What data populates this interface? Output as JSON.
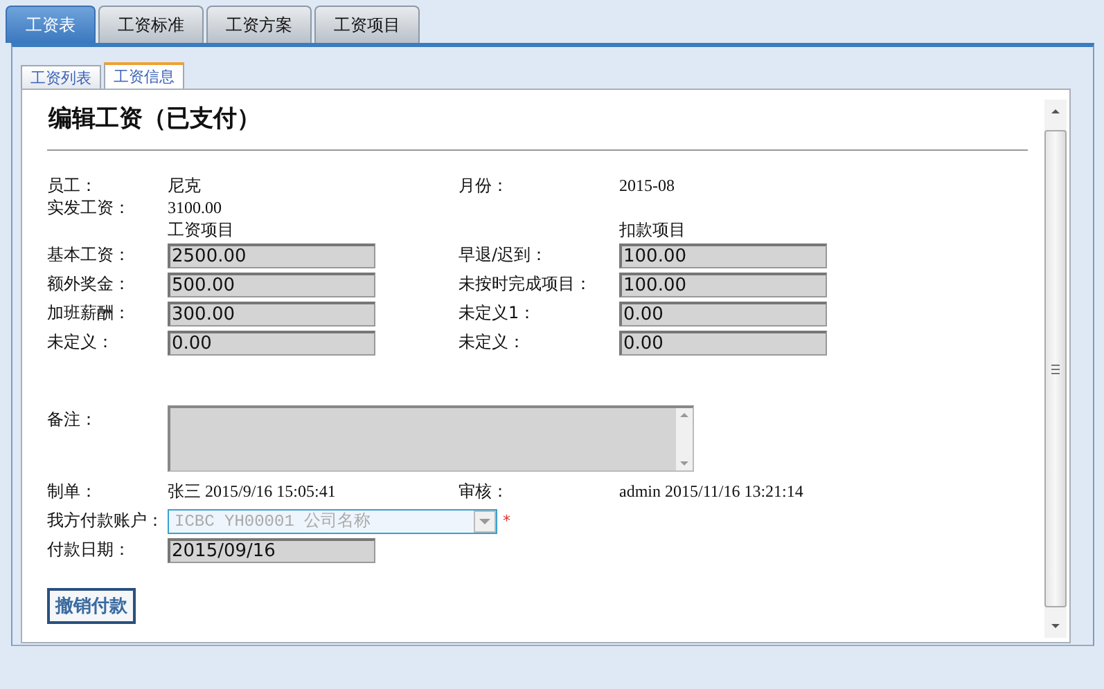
{
  "main_tabs": [
    {
      "label": "工资表",
      "selected": true
    },
    {
      "label": "工资标准",
      "selected": false
    },
    {
      "label": "工资方案",
      "selected": false
    },
    {
      "label": "工资项目",
      "selected": false
    }
  ],
  "sub_tabs": [
    {
      "label": "工资列表",
      "selected": false
    },
    {
      "label": "工资信息",
      "selected": true
    }
  ],
  "form": {
    "title": "编辑工资（已支付）",
    "employee": {
      "label": "员工：",
      "value": "尼克"
    },
    "month": {
      "label": "月份：",
      "value": "2015-08"
    },
    "net_pay": {
      "label": "实发工资：",
      "value": "3100.00"
    },
    "income_heading": "工资项目",
    "deduction_heading": "扣款项目",
    "income_items": [
      {
        "label": "基本工资：",
        "value": "2500.00"
      },
      {
        "label": "额外奖金：",
        "value": "500.00"
      },
      {
        "label": "加班薪酬：",
        "value": "300.00"
      },
      {
        "label": "未定义：",
        "value": "0.00"
      }
    ],
    "deduction_items": [
      {
        "label": "早退/迟到：",
        "value": "100.00"
      },
      {
        "label": "未按时完成项目：",
        "value": "100.00"
      },
      {
        "label": "未定义1：",
        "value": "0.00"
      },
      {
        "label": "未定义：",
        "value": "0.00"
      }
    ],
    "remarks": {
      "label": "备注："
    },
    "prepared_by": {
      "label": "制单：",
      "value": "张三 2015/9/16 15:05:41"
    },
    "reviewed_by": {
      "label": "审核：",
      "value": "admin 2015/11/16 13:21:14"
    },
    "account": {
      "label": "我方付款账户：",
      "value": "ICBC YH00001 公司名称",
      "disabled": true,
      "required_mark": "*"
    },
    "payment_date": {
      "label": "付款日期：",
      "value": "2015/09/16"
    },
    "button": "撤销付款"
  }
}
